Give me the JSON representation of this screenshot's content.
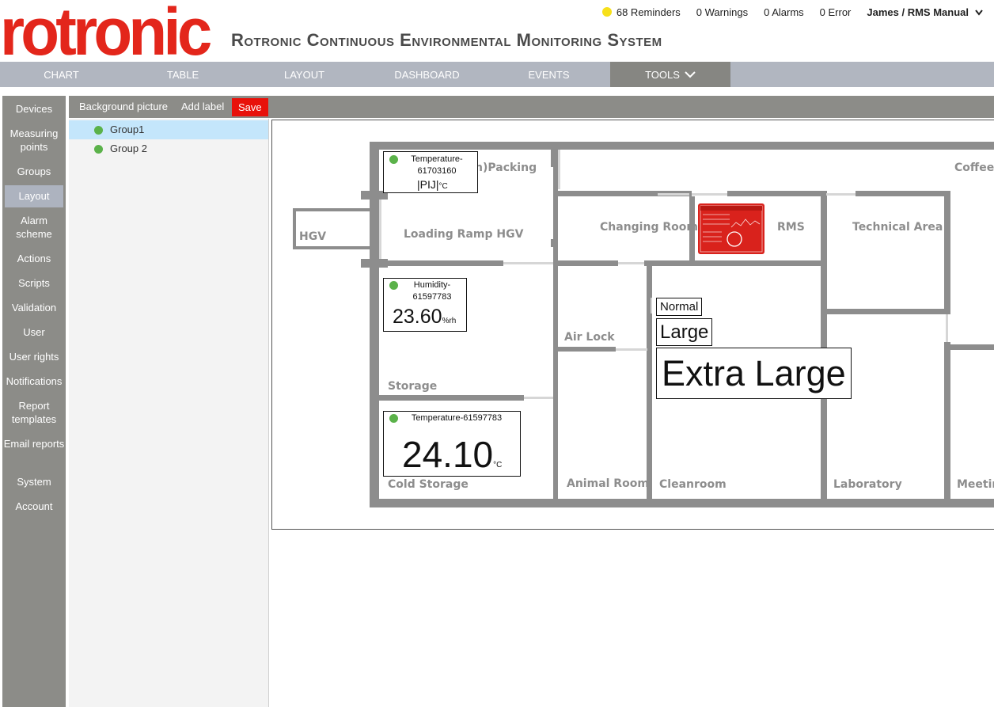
{
  "header": {
    "logo_text": "rotronic",
    "app_title": "Rotronic Continuous Environmental Monitoring System",
    "reminders": "68 Reminders",
    "warnings": "0 Warnings",
    "alarms": "0 Alarms",
    "errors": "0 Error",
    "user": "James / RMS Manual"
  },
  "top_nav": [
    "CHART",
    "TABLE",
    "LAYOUT",
    "DASHBOARD",
    "EVENTS",
    "TOOLS"
  ],
  "sidebar": [
    "Devices",
    "Measuring points",
    "Groups",
    "Layout",
    "Alarm scheme",
    "Actions",
    "Scripts",
    "Validation",
    "User",
    "User rights",
    "Notifications",
    "Report templates",
    "Email reports",
    "System",
    "Account"
  ],
  "toolbar": {
    "background": "Background picture",
    "add_label": "Add label",
    "save": "Save"
  },
  "groups": [
    "Group1",
    "Group 2"
  ],
  "rooms": {
    "packing": "n)Packing",
    "coffee": "Coffee C",
    "hgv": "HGV",
    "loading": "Loading Ramp HGV",
    "changing": "Changing Room",
    "rms": "RMS",
    "technical": "Technical Area",
    "airlock": "Air Lock",
    "storage": "Storage",
    "cold": "Cold Storage",
    "animal": "Animal Room",
    "cleanroom": "Cleanroom",
    "laboratory": "Laboratory",
    "meeting": "Meeting"
  },
  "sensors": [
    {
      "name": "Temperature-61703160",
      "value": "|PIJ|",
      "unit": "°C"
    },
    {
      "name": "Humidity-61597783",
      "value": "23.60",
      "unit": "%rh"
    },
    {
      "name": "Temperature-61597783",
      "value": "24.10",
      "unit": "°C"
    }
  ],
  "labels": {
    "normal": "Normal",
    "large": "Large",
    "extra_large": "Extra Large"
  },
  "colors": {
    "brand_red": "#e3261b",
    "save_red": "#e8110a",
    "status_green": "#5bb24a",
    "reminder_yellow": "#f7e01a",
    "nav_gray": "#b1b6c0",
    "sidebar_gray": "#8c8c88"
  }
}
